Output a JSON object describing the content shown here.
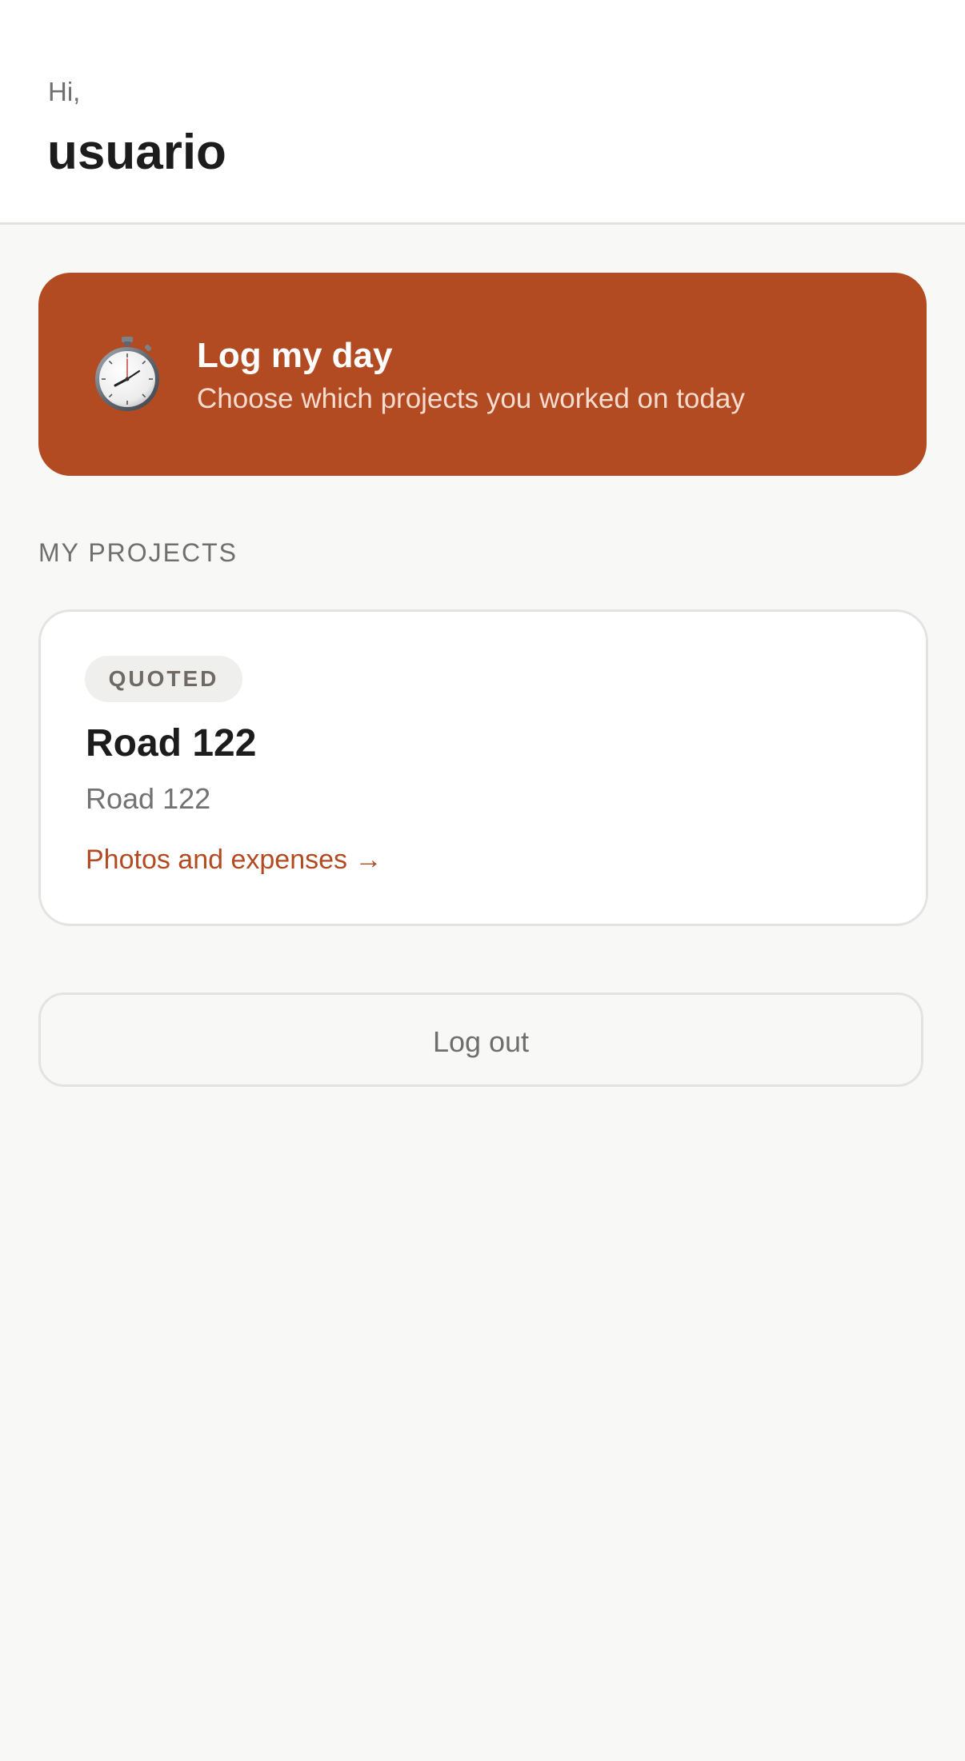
{
  "header": {
    "greeting": "Hi,",
    "username": "usuario"
  },
  "log_day": {
    "icon": "stopwatch-icon",
    "title": "Log my day",
    "subtitle": "Choose which projects you worked on today"
  },
  "projects_section": {
    "title": "MY PROJECTS",
    "items": [
      {
        "status": "QUOTED",
        "name": "Road 122",
        "address": "Road 122",
        "link_label": "Photos and expenses →"
      }
    ]
  },
  "logout": {
    "label": "Log out"
  },
  "colors": {
    "accent": "#b34b22",
    "background": "#f8f8f6",
    "surface": "#ffffff",
    "border": "#e3e3e1",
    "text_primary": "#1c1c1c",
    "text_secondary": "#707070"
  }
}
